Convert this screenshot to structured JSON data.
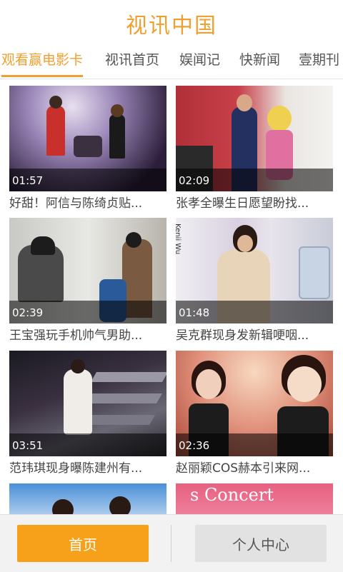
{
  "header": {
    "title": "视讯中国"
  },
  "tabs": [
    {
      "label": "观看赢电影卡"
    },
    {
      "label": "视讯首页"
    },
    {
      "label": "娱闻记"
    },
    {
      "label": "快新闻"
    },
    {
      "label": "壹期刊"
    }
  ],
  "videos": [
    {
      "duration": "01:57",
      "title": "好甜！阿信与陈绮贞贴..."
    },
    {
      "duration": "02:09",
      "title": "张孝全曝生日愿望盼找..."
    },
    {
      "duration": "02:39",
      "title": "王宝强玩手机帅气男助..."
    },
    {
      "duration": "01:48",
      "title": "吴克群现身发新辑哽咽..."
    },
    {
      "duration": "03:51",
      "title": "范玮琪现身曝陈建州有..."
    },
    {
      "duration": "02:36",
      "title": "赵丽颖COS赫本引来网..."
    }
  ],
  "partial_thumbs": [
    {
      "text": ""
    },
    {
      "text": "s Concert"
    }
  ],
  "thumb_text": {
    "kenji": "Kenji Wu"
  },
  "bottom_nav": {
    "home": "首页",
    "profile": "个人中心"
  },
  "colors": {
    "accent": "#f0a030",
    "home_button": "#f7a11a"
  }
}
